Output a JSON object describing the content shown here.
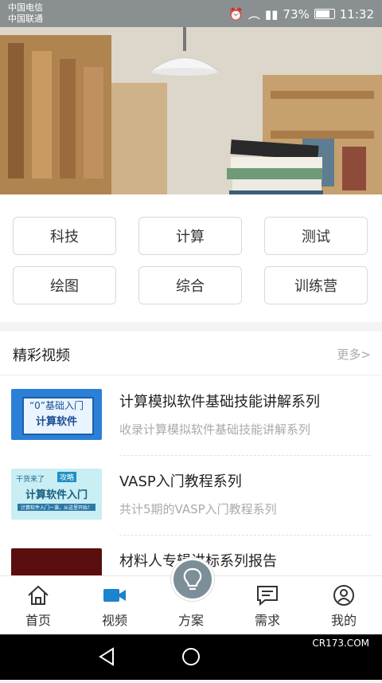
{
  "statusbar": {
    "carrier1": "中国电信",
    "carrier2": "中国联通",
    "battery": "73%",
    "time": "11:32"
  },
  "categories": [
    "科技",
    "计算",
    "测试",
    "绘图",
    "综合",
    "训练营"
  ],
  "videos": {
    "section_title": "精彩视频",
    "more_label": "更多>",
    "items": [
      {
        "title": "计算模拟软件基础技能讲解系列",
        "subtitle": "收录计算模拟软件基础技能讲解系列",
        "thumb_line1": "“0”基础入门",
        "thumb_line2": "计算软件",
        "thumb_badge": "",
        "thumb_small": ""
      },
      {
        "title": "VASP入门教程系列",
        "subtitle": "共计5期的VASP入门教程系列",
        "thumb_line1": "干货来了",
        "thumb_line2": "计算软件入门",
        "thumb_badge": "攻略",
        "thumb_small": "计算软件入门一课，从这里开始！"
      },
      {
        "title": "材料人专辑讲标系列报告",
        "subtitle": ""
      }
    ]
  },
  "tabbar": [
    {
      "label": "首页",
      "icon": "home-icon"
    },
    {
      "label": "视频",
      "icon": "video-camera-icon"
    },
    {
      "label": "方案",
      "icon": "lightbulb-icon"
    },
    {
      "label": "需求",
      "icon": "message-icon"
    },
    {
      "label": "我的",
      "icon": "user-icon"
    }
  ],
  "watermark": "CR173.COM"
}
